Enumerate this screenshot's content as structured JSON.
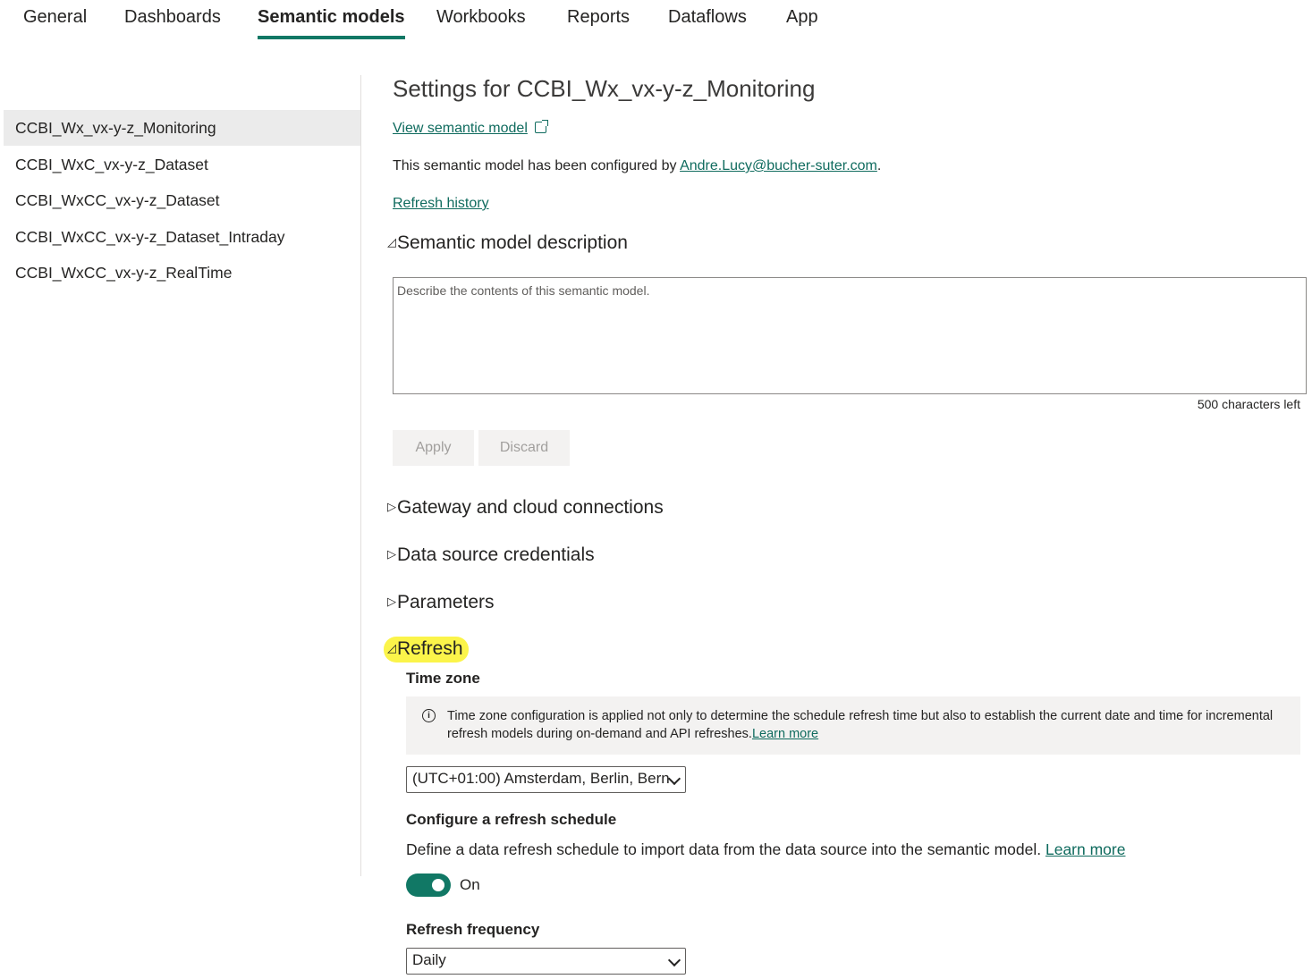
{
  "tabs": [
    {
      "label": "General"
    },
    {
      "label": "Dashboards"
    },
    {
      "label": "Semantic models"
    },
    {
      "label": "Workbooks"
    },
    {
      "label": "Reports"
    },
    {
      "label": "Dataflows"
    },
    {
      "label": "App"
    }
  ],
  "active_tab": "Semantic models",
  "sidebar": {
    "items": [
      {
        "label": "CCBI_Wx_vx-y-z_Monitoring"
      },
      {
        "label": "CCBI_WxC_vx-y-z_Dataset"
      },
      {
        "label": "CCBI_WxCC_vx-y-z_Dataset"
      },
      {
        "label": "CCBI_WxCC_vx-y-z_Dataset_Intraday"
      },
      {
        "label": "CCBI_WxCC_vx-y-z_RealTime"
      }
    ],
    "selected": "CCBI_Wx_vx-y-z_Monitoring"
  },
  "main": {
    "title": "Settings for CCBI_Wx_vx-y-z_Monitoring",
    "view_link": "View semantic model",
    "configured_prefix": "This semantic model has been configured by ",
    "configured_email": "Andre.Lucy@bucher-suter.com",
    "configured_suffix": ".",
    "refresh_history": "Refresh history",
    "description_section": {
      "title": "Semantic model description",
      "placeholder": "Describe the contents of this semantic model.",
      "chars_left": "500 characters left",
      "apply": "Apply",
      "discard": "Discard"
    },
    "collapsed_sections": [
      {
        "title": "Gateway and cloud connections"
      },
      {
        "title": "Data source credentials"
      },
      {
        "title": "Parameters"
      }
    ],
    "refresh_section": {
      "title": "Refresh",
      "time_zone_label": "Time zone",
      "info_text": "Time zone configuration is applied not only to determine the schedule refresh time but also to establish the current date and time for incremental refresh models during on-demand and API refreshes.",
      "info_link": "Learn more",
      "time_zone_value": "(UTC+01:00) Amsterdam, Berlin, Bern",
      "schedule_label": "Configure a refresh schedule",
      "schedule_desc": "Define a data refresh schedule to import data from the data source into the semantic model.",
      "schedule_link": "Learn more",
      "toggle_state": "On",
      "frequency_label": "Refresh frequency",
      "frequency_value": "Daily"
    }
  },
  "colors": {
    "accent": "#117865",
    "link": "#0f6b5e",
    "highlight": "#fbf44a",
    "selected_bg": "#ebebeb"
  },
  "icons": {
    "expanded": "expanded-triangle-icon",
    "collapsed": "collapsed-triangle-icon",
    "external": "external-link-icon",
    "info": "info-icon",
    "dropdown": "chevron-down-icon"
  }
}
